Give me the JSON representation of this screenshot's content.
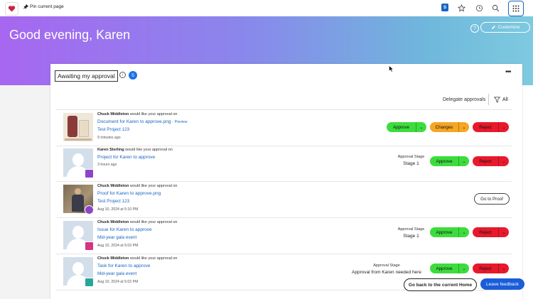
{
  "topbar": {
    "pin_label": "Pin current page",
    "badge_letter": "S",
    "icons": [
      "star-icon",
      "history-icon",
      "search-icon",
      "apps-grid-icon"
    ]
  },
  "hero": {
    "greeting": "Good evening, Karen",
    "customize_label": "Customize",
    "help_symbol": "?"
  },
  "approvals": {
    "title": "Awaiting my approval",
    "count": "5",
    "delegate_label": "Delegate approvals",
    "filter_label": "All",
    "items": [
      {
        "requester": "Chuck Middleton",
        "request_text": "would like your approval on",
        "item_name": "Document for Karen to approve.png",
        "preview_label": "Preview",
        "project": "Test Project 123",
        "time": "9 minutes ago",
        "actions": {
          "approve": "Approve",
          "changes": "Changes",
          "reject": "Reject"
        }
      },
      {
        "requester": "Karen Sterling",
        "request_text": "would like your approval on",
        "item_name": "Project for Karen to approve",
        "time": "3 hours ago",
        "stage_label": "Approval Stage",
        "stage_value": "Stage 1",
        "actions": {
          "approve": "Approve",
          "reject": "Reject"
        }
      },
      {
        "requester": "Chuck Middleton",
        "request_text": "would like your approval on",
        "item_name": "Proof for Karen to approve.png",
        "project": "Test Project 123",
        "time": "Aug 10, 2024 at 5:10 PM",
        "actions": {
          "goto": "Go to Proof"
        }
      },
      {
        "requester": "Chuck Middleton",
        "request_text": "would like your approval on",
        "item_name": "Issue for Karen to approve",
        "project": "Mid-year gala event",
        "time": "Aug 10, 2024 at 5:03 PM",
        "stage_label": "Approval Stage",
        "stage_value": "Stage 1",
        "actions": {
          "approve": "Approve",
          "reject": "Reject"
        }
      },
      {
        "requester": "Chuck Middleton",
        "request_text": "would like your approval on",
        "item_name": "Task for Karen to approve",
        "project": "Mid-year gala event",
        "time": "Aug 10, 2024 at 5:02 PM",
        "stage_label": "Approval Stage",
        "stage_value": "Approval from Karen needed here",
        "actions": {
          "approve": "Approve",
          "reject": "Reject"
        }
      }
    ]
  },
  "footer": {
    "go_back_label": "Go back to the current Home",
    "feedback_label": "Leave feedback"
  },
  "colors": {
    "approve": "#3ddc3d",
    "changes": "#f5a623",
    "reject": "#e8192c",
    "link": "#1565c0",
    "project_badge": "#8e44c9",
    "proof_badge": "#8e44c9",
    "issue_badge": "#d63384",
    "task_badge": "#26a69a"
  }
}
